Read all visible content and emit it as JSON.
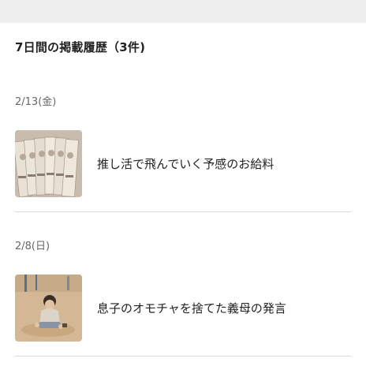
{
  "history": {
    "title": "7日間の掲載履歴（3件)",
    "entries": [
      {
        "date": "2/13(金)",
        "headline": "推し活で飛んでいく予感のお給料",
        "thumbnail_icon": "banknotes-photo-icon"
      },
      {
        "date": "2/8(日)",
        "headline": "息子のオモチャを捨てた義母の発言",
        "thumbnail_icon": "child-playing-sand-photo-icon"
      }
    ]
  }
}
